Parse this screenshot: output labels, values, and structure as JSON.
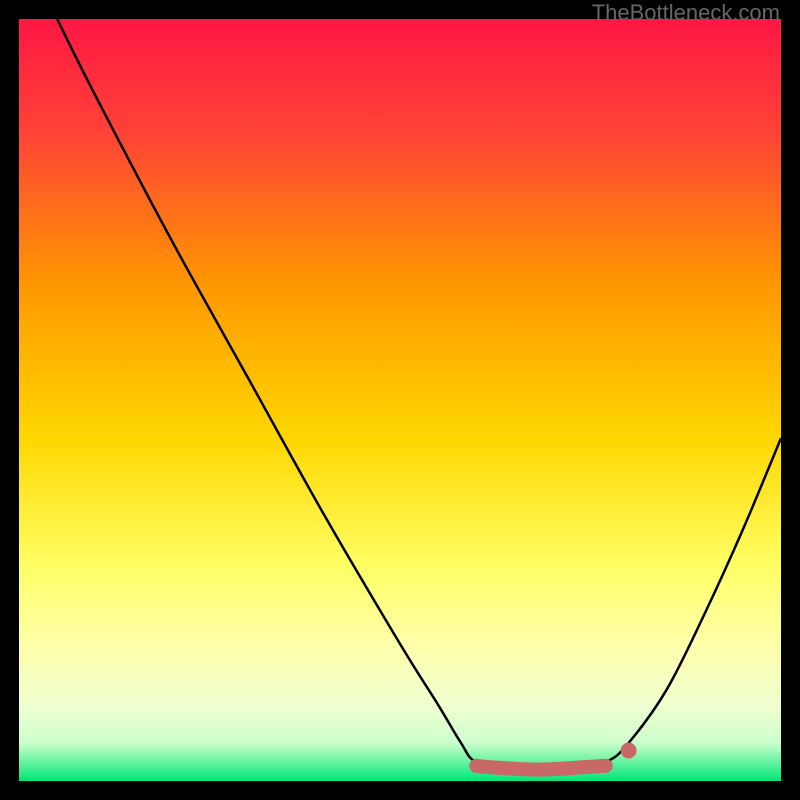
{
  "attribution": "TheBottleneck.com",
  "chart_data": {
    "type": "line",
    "title": "",
    "xlabel": "",
    "ylabel": "",
    "x_range": [
      0,
      100
    ],
    "y_range": [
      0,
      100
    ],
    "gradient_stops": [
      {
        "offset": 0.0,
        "color": "#ff1744"
      },
      {
        "offset": 0.15,
        "color": "#ff4336"
      },
      {
        "offset": 0.35,
        "color": "#ff9800"
      },
      {
        "offset": 0.55,
        "color": "#ffd700"
      },
      {
        "offset": 0.72,
        "color": "#ffff66"
      },
      {
        "offset": 0.82,
        "color": "#ffffaa"
      },
      {
        "offset": 0.9,
        "color": "#f0ffd0"
      },
      {
        "offset": 0.95,
        "color": "#ccffcc"
      },
      {
        "offset": 1.0,
        "color": "#00e676"
      }
    ],
    "series": [
      {
        "name": "bottleneck-curve",
        "type": "line",
        "color": "#000000",
        "width": 2.5,
        "points": [
          {
            "x": 5,
            "y": 100
          },
          {
            "x": 10,
            "y": 90
          },
          {
            "x": 20,
            "y": 71
          },
          {
            "x": 30,
            "y": 53
          },
          {
            "x": 40,
            "y": 35
          },
          {
            "x": 50,
            "y": 18
          },
          {
            "x": 55,
            "y": 10
          },
          {
            "x": 58,
            "y": 5
          },
          {
            "x": 60,
            "y": 2.5
          },
          {
            "x": 65,
            "y": 1.5
          },
          {
            "x": 72,
            "y": 1.5
          },
          {
            "x": 77,
            "y": 2.5
          },
          {
            "x": 80,
            "y": 5
          },
          {
            "x": 85,
            "y": 12
          },
          {
            "x": 90,
            "y": 22
          },
          {
            "x": 95,
            "y": 33
          },
          {
            "x": 100,
            "y": 45
          }
        ]
      },
      {
        "name": "optimal-band",
        "type": "thick-line",
        "color": "#c96868",
        "width": 14,
        "cap": "round",
        "points": [
          {
            "x": 60,
            "y": 2.0
          },
          {
            "x": 62,
            "y": 1.8
          },
          {
            "x": 68,
            "y": 1.5
          },
          {
            "x": 74,
            "y": 1.8
          },
          {
            "x": 77,
            "y": 2.0
          }
        ]
      },
      {
        "name": "optimal-point",
        "type": "point",
        "color": "#c96868",
        "radius": 8,
        "x": 80,
        "y": 4
      }
    ]
  }
}
